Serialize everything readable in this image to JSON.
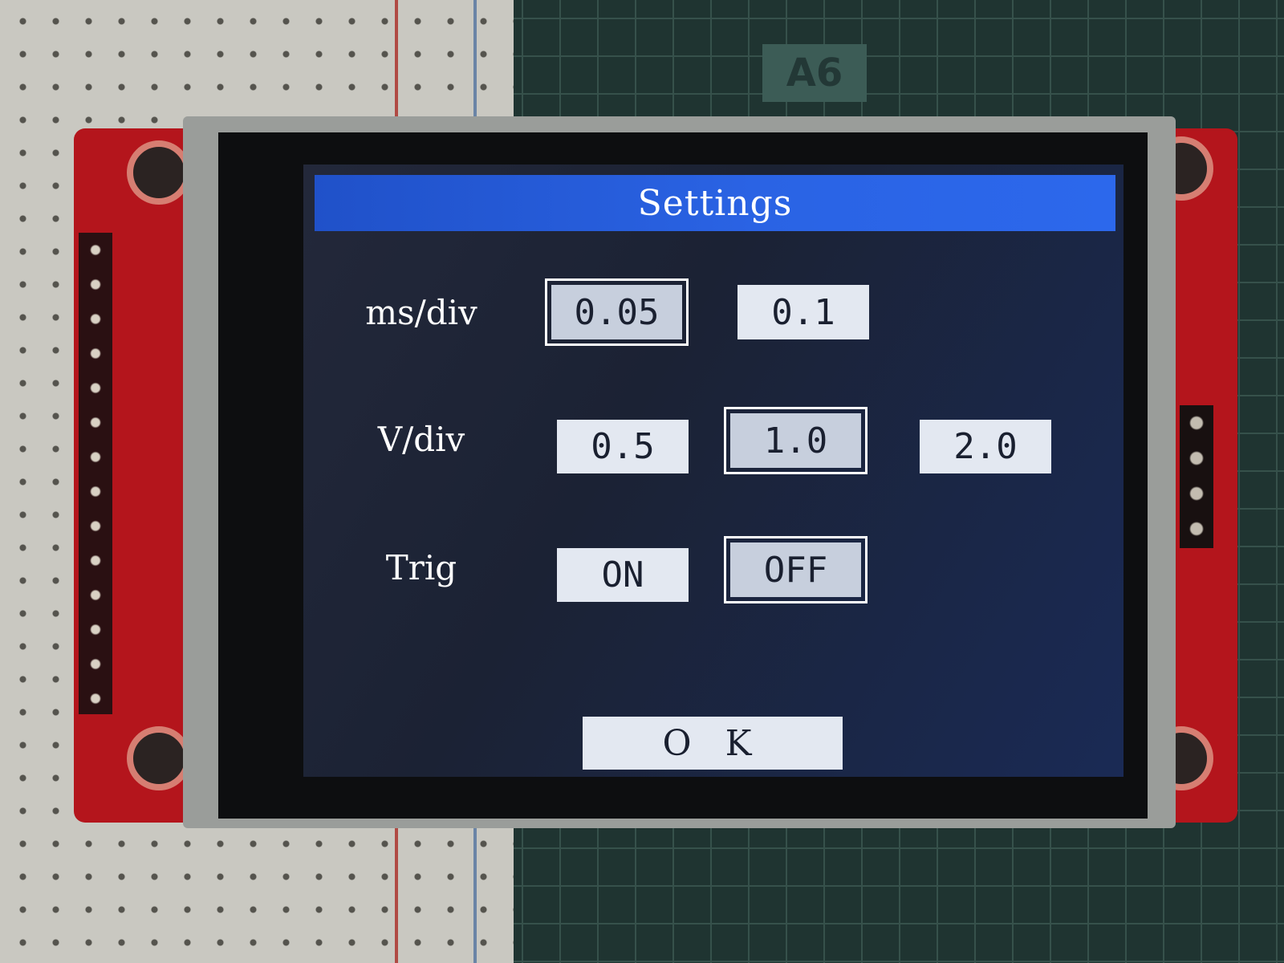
{
  "background": {
    "mat_label": "A6"
  },
  "settings": {
    "title": "Settings",
    "rows": [
      {
        "label": "ms/div",
        "options": [
          "0.05",
          "0.1"
        ],
        "selected": "0.05"
      },
      {
        "label": "V/div",
        "options": [
          "0.5",
          "1.0",
          "2.0"
        ],
        "selected": "1.0"
      },
      {
        "label": "Trig",
        "options": [
          "ON",
          "OFF"
        ],
        "selected": "OFF"
      }
    ],
    "ok_label": "O K"
  },
  "colors": {
    "title_bar": "#2a63e4",
    "screen_bg": "#1b2234",
    "button_bg": "#e3e8f1",
    "selected_outline": "#ffffff"
  }
}
